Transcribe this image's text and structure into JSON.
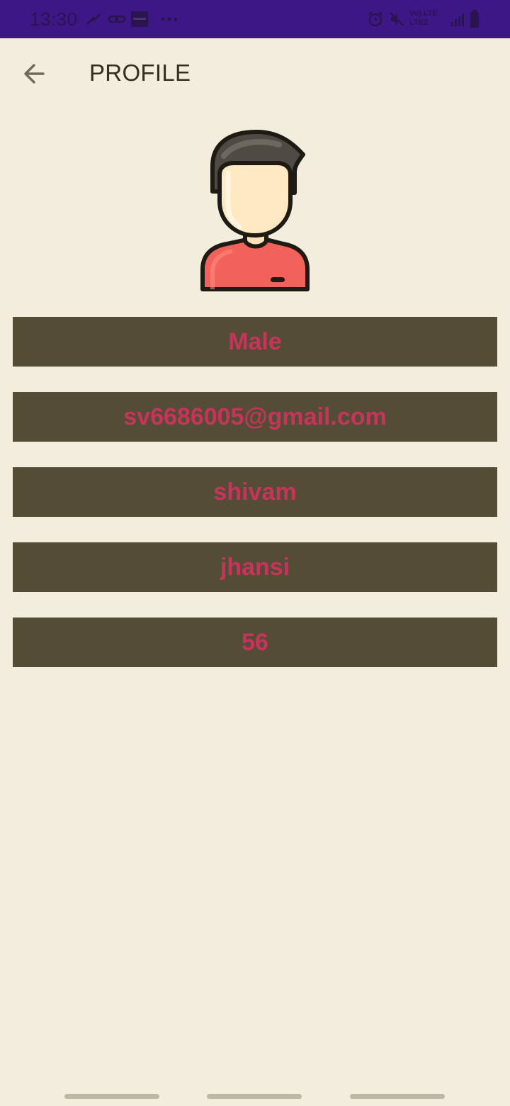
{
  "status_bar": {
    "time": "13:30",
    "left_icons": [
      "route-icon",
      "link-icon",
      "image-thumbnail-icon",
      "more-dots-icon"
    ],
    "right_icons": [
      "alarm-icon",
      "mute-icon",
      "volte-lte2-icon",
      "signal-icon",
      "battery-icon"
    ],
    "network_labels": {
      "top": "Vo) LTE",
      "bottom": "LTE2"
    },
    "background_color": "#3E1786"
  },
  "toolbar": {
    "back_icon": "arrow-back-icon",
    "title": "PROFILE"
  },
  "avatar": {
    "icon": "user-avatar-icon"
  },
  "profile": {
    "gender": "Male",
    "email": "sv6686005@gmail.com",
    "name": "shivam",
    "city": "jhansi",
    "age": "56"
  },
  "colors": {
    "background": "#F2EDDC",
    "field_background": "#554C36",
    "field_text": "#C8335C",
    "title_text": "#33301F"
  },
  "navigation_bar": {
    "handles": 3
  }
}
